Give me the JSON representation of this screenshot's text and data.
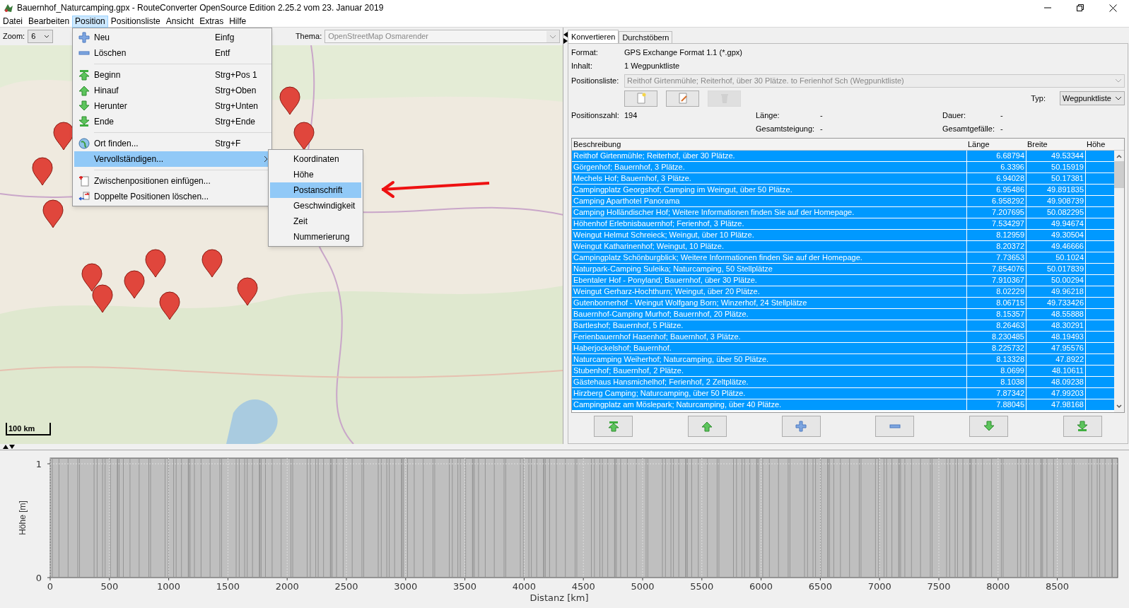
{
  "window": {
    "title": "Bauernhof_Naturcamping.gpx - RouteConverter OpenSource Edition 2.25.2 vom 23. Januar 2019"
  },
  "menu_bar": [
    {
      "label": "Datei",
      "selected": false
    },
    {
      "label": "Bearbeiten",
      "selected": false
    },
    {
      "label": "Position",
      "selected": true
    },
    {
      "label": "Positionsliste",
      "selected": false
    },
    {
      "label": "Ansicht",
      "selected": false
    },
    {
      "label": "Extras",
      "selected": false
    },
    {
      "label": "Hilfe",
      "selected": false
    }
  ],
  "map_toolbar": {
    "zoom_label": "Zoom:",
    "zoom_value": "6",
    "theme_label": "Thema:",
    "theme_value": "OpenStreetMap Osmarender"
  },
  "map": {
    "kind": "picture",
    "scale_label": "100 km"
  },
  "position_menu": [
    {
      "kind": "item",
      "label": "Neu",
      "shortcut": "Einfg",
      "selected": false
    },
    {
      "kind": "item",
      "label": "Löschen",
      "shortcut": "Entf",
      "selected": false
    },
    {
      "kind": "separator"
    },
    {
      "kind": "item",
      "label": "Beginn",
      "shortcut": "Strg+Pos 1",
      "selected": false
    },
    {
      "kind": "item",
      "label": "Hinauf",
      "shortcut": "Strg+Oben",
      "selected": false
    },
    {
      "kind": "item",
      "label": "Herunter",
      "shortcut": "Strg+Unten",
      "selected": false
    },
    {
      "kind": "item",
      "label": "Ende",
      "shortcut": "Strg+Ende",
      "selected": false
    },
    {
      "kind": "separator"
    },
    {
      "kind": "item",
      "label": "Ort finden...",
      "shortcut": "Strg+F",
      "selected": false
    },
    {
      "kind": "submenu",
      "label": "Vervollständigen...",
      "selected": true
    },
    {
      "kind": "separator"
    },
    {
      "kind": "item",
      "label": "Zwischenpositionen einfügen...",
      "selected": false
    },
    {
      "kind": "item",
      "label": "Doppelte Positionen löschen...",
      "selected": false
    }
  ],
  "submenu": [
    {
      "label": "Koordinaten",
      "selected": false
    },
    {
      "label": "Höhe",
      "selected": false
    },
    {
      "label": "Postanschrift",
      "selected": true
    },
    {
      "label": "Geschwindigkeit",
      "selected": false
    },
    {
      "label": "Zeit",
      "selected": false
    },
    {
      "label": "Nummerierung",
      "selected": false
    }
  ],
  "tabs": [
    {
      "label": "Konvertieren",
      "selected": true
    },
    {
      "label": "Durchstöbern",
      "selected": false
    }
  ],
  "info": {
    "format_label": "Format:",
    "format_value": "GPS Exchange Format 1.1 (*.gpx)",
    "content_label": "Inhalt:",
    "content_value": "1 Wegpunktliste",
    "list_label": "Positionsliste:",
    "list_value": "Reithof Girtenmühle; Reiterhof, über 30 Plätze. to Ferienhof Sch (Wegpunktliste)",
    "type_label": "Typ:",
    "type_value": "Wegpunktliste"
  },
  "list_buttons": [
    {
      "disabled": false
    },
    {
      "disabled": false
    },
    {
      "disabled": true
    }
  ],
  "stats": {
    "count_label": "Positionszahl:",
    "count_value": "194",
    "length_label": "Länge:",
    "length_value": "-",
    "duration_label": "Dauer:",
    "duration_value": "-",
    "ascent_label": "Gesamtsteigung:",
    "ascent_value": "-",
    "descent_label": "Gesamtgefälle:",
    "descent_value": "-"
  },
  "table": {
    "columns": [
      "Beschreibung",
      "Länge",
      "Breite",
      "Höhe"
    ],
    "rows": [
      {
        "description": "Reithof Girtenmühle; Reiterhof, über 30 Plätze.",
        "longitude": "6.68794",
        "latitude": "49.53344",
        "selected": true
      },
      {
        "description": "Görgenhof; Bauernhof, 3 Plätze.",
        "longitude": "6.3396",
        "latitude": "50.15919",
        "selected": true
      },
      {
        "description": "Mechels Hof; Bauernhof, 3 Plätze.",
        "longitude": "6.94028",
        "latitude": "50.17381",
        "selected": true
      },
      {
        "description": "Campingplatz Georgshof; Camping im Weingut, über 50 Plätze.",
        "longitude": "6.95486",
        "latitude": "49.891835",
        "selected": true
      },
      {
        "description": "Camping Aparthotel Panorama",
        "longitude": "6.958292",
        "latitude": "49.908739",
        "selected": true
      },
      {
        "description": "Camping Holländischer Hof; Weitere Informationen finden Sie auf der Homepage.",
        "longitude": "7.207695",
        "latitude": "50.082295",
        "selected": true
      },
      {
        "description": "Höhenhof Erlebnisbauernhof; Ferienhof, 3 Plätze.",
        "longitude": "7.534297",
        "latitude": "49.94674",
        "selected": true
      },
      {
        "description": "Weingut Helmut Schreieck; Weingut, über 10 Plätze.",
        "longitude": "8.12959",
        "latitude": "49.30504",
        "selected": true
      },
      {
        "description": "Weingut Katharinenhof; Weingut, 10 Plätze.",
        "longitude": "8.20372",
        "latitude": "49.46666",
        "selected": true
      },
      {
        "description": "Campingplatz Schönburgblick; Weitere Informationen finden Sie auf der Homepage.",
        "longitude": "7.73653",
        "latitude": "50.1024",
        "selected": true
      },
      {
        "description": "Naturpark-Camping Suleika; Naturcamping, 50 Stellplätze",
        "longitude": "7.854076",
        "latitude": "50.017839",
        "selected": true
      },
      {
        "description": "Ebentaler Hof - Ponyland; Bauernhof, über 30 Plätze.",
        "longitude": "7.910367",
        "latitude": "50.00294",
        "selected": true
      },
      {
        "description": "Weingut Gerharz-Hochthurn; Weingut, über 20 Plätze.",
        "longitude": "8.02229",
        "latitude": "49.96218",
        "selected": true
      },
      {
        "description": "Gutenbornerhof - Weingut Wolfgang Born; Winzerhof, 24 Stellplätze",
        "longitude": "8.06715",
        "latitude": "49.733426",
        "selected": true
      },
      {
        "description": "Bauernhof-Camping Murhof; Bauernhof, 20 Plätze.",
        "longitude": "8.15357",
        "latitude": "48.55888",
        "selected": true
      },
      {
        "description": "Bartleshof; Bauernhof, 5 Plätze.",
        "longitude": "8.26463",
        "latitude": "48.30291",
        "selected": true
      },
      {
        "description": "Ferienbauernhof Hasenhof; Bauernhof, 3 Plätze.",
        "longitude": "8.230485",
        "latitude": "48.19493",
        "selected": true
      },
      {
        "description": "Haberjockelshof; Bauernhof.",
        "longitude": "8.225732",
        "latitude": "47.95576",
        "selected": true
      },
      {
        "description": "Naturcamping Weiherhof; Naturcamping, über 50 Plätze.",
        "longitude": "8.13328",
        "latitude": "47.8922",
        "selected": true
      },
      {
        "description": "Stubenhof; Bauernhof, 2 Plätze.",
        "longitude": "8.0699",
        "latitude": "48.10611",
        "selected": true
      },
      {
        "description": "Gästehaus Hansmichelhof; Ferienhof, 2 Zeltplätze.",
        "longitude": "8.1038",
        "latitude": "48.09238",
        "selected": true
      },
      {
        "description": "Hirzberg Camping; Naturcamping, über 50 Plätze.",
        "longitude": "7.87342",
        "latitude": "47.99203",
        "selected": true
      },
      {
        "description": "Campingplatz am Möslepark; Naturcamping, über 40 Plätze.",
        "longitude": "7.88045",
        "latitude": "47.98168",
        "selected": true
      }
    ]
  },
  "elevation_chart": {
    "ylabel": "Höhe [m]",
    "xlabel": "Distanz [km]",
    "yticks": [
      "1",
      "0"
    ],
    "xticks": [
      "0",
      "500",
      "1000",
      "1500",
      "2000",
      "2500",
      "3000",
      "3500",
      "4000",
      "4500",
      "5000",
      "5500",
      "6000",
      "6500",
      "7000",
      "7500",
      "8000",
      "8500"
    ]
  }
}
